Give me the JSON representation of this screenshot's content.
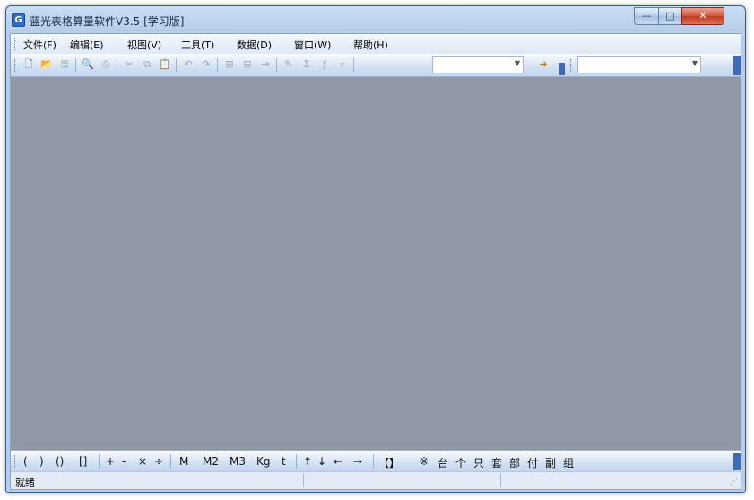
{
  "window": {
    "title": "蓝光表格算量软件V3.5 [学习版]",
    "icon_letter": "G",
    "minimize_glyph": "—",
    "maximize_glyph": "□",
    "close_glyph": "✕"
  },
  "menubar": {
    "items": [
      "文件(F)",
      "编辑(E)",
      "视图(V)",
      "工具(T)",
      "数据(D)",
      "窗口(W)",
      "帮助(H)"
    ]
  },
  "toolbar": {
    "buttons": [
      {
        "icon": "new-file-icon",
        "glyph": "🗋",
        "enabled": true
      },
      {
        "icon": "open-folder-icon",
        "glyph": "📂",
        "enabled": true
      },
      {
        "icon": "save-icon",
        "glyph": "🖫",
        "enabled": false
      },
      {
        "icon": "print-preview-icon",
        "glyph": "🔍",
        "enabled": false
      },
      {
        "icon": "print-icon",
        "glyph": "⎙",
        "enabled": false
      },
      {
        "icon": "cut-icon",
        "glyph": "✂",
        "enabled": false
      },
      {
        "icon": "copy-icon",
        "glyph": "⧉",
        "enabled": false
      },
      {
        "icon": "paste-icon",
        "glyph": "📋",
        "enabled": false
      },
      {
        "icon": "undo-icon",
        "glyph": "↶",
        "enabled": false
      },
      {
        "icon": "redo-icon",
        "glyph": "↷",
        "enabled": false
      },
      {
        "icon": "insert-row-icon",
        "glyph": "⊞",
        "enabled": false
      },
      {
        "icon": "delete-row-icon",
        "glyph": "⊟",
        "enabled": false
      },
      {
        "icon": "move-row-icon",
        "glyph": "⇥",
        "enabled": false
      },
      {
        "icon": "edit-icon",
        "glyph": "✎",
        "enabled": false
      },
      {
        "icon": "sum-icon",
        "glyph": "Σ",
        "enabled": false
      },
      {
        "icon": "formula-icon",
        "glyph": "ƒ",
        "enabled": false
      },
      {
        "icon": "zoom-icon",
        "glyph": "⌕",
        "enabled": false
      }
    ],
    "combo1_value": "",
    "combo2_value": "",
    "special_button_icon": "project-arrow-icon",
    "special_button_glyph": "➜"
  },
  "symbolbar": {
    "groups": [
      [
        "(",
        ")",
        "()",
        "[]"
      ],
      [
        "+",
        "-",
        "×",
        "÷"
      ],
      [
        "M",
        "M2",
        "M3",
        "Kg",
        "t"
      ],
      [
        "↑",
        "↓",
        "←",
        "→"
      ],
      [
        "【】",
        "※",
        "台",
        "个",
        "只",
        "套",
        "部",
        "付",
        "副",
        "组"
      ]
    ]
  },
  "statusbar": {
    "text": "就绪",
    "grip_glyph": "⋰"
  },
  "colors": {
    "workspace": "#9098a8",
    "title_blue": "#c9dcf3",
    "close_red": "#c03a20"
  }
}
